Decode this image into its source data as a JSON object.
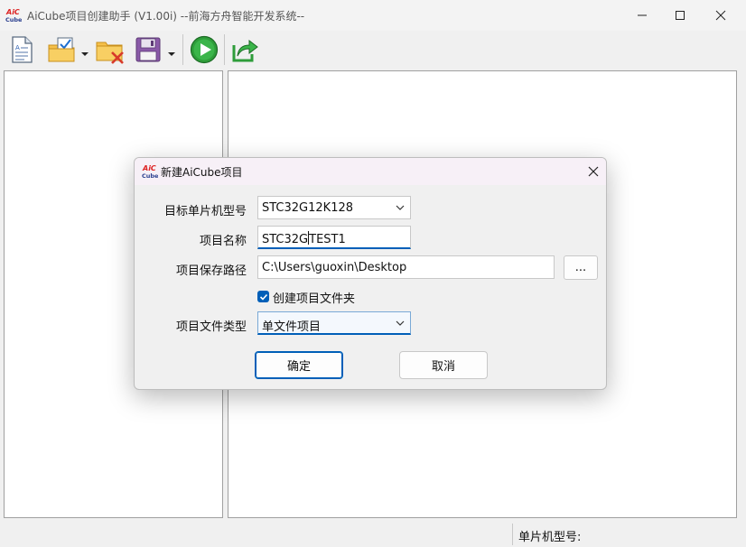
{
  "window": {
    "title": "AiCube项目创建助手 (V1.00i) --前海方舟智能开发系统--",
    "logo_text_top": "AiC",
    "logo_text_bottom": "Cube"
  },
  "toolbar": {
    "items": [
      {
        "name": "new-file",
        "icon": "new-document-icon"
      },
      {
        "name": "open-project",
        "icon": "folder-check-icon",
        "has_dropdown": true
      },
      {
        "name": "close-project",
        "icon": "folder-delete-icon"
      },
      {
        "name": "save",
        "icon": "floppy-disk-icon",
        "has_dropdown": true
      },
      {
        "name": "run",
        "icon": "play-icon"
      },
      {
        "name": "export",
        "icon": "share-arrow-icon"
      }
    ]
  },
  "statusbar": {
    "mcu_label": "单片机型号:"
  },
  "dialog": {
    "title": "新建AiCube项目",
    "fields": {
      "mcu_model_label": "目标单片机型号",
      "mcu_model_value": "STC32G12K128",
      "project_name_label": "项目名称",
      "project_name_before_caret": "STC32G",
      "project_name_after_caret": "TEST1",
      "save_path_label": "项目保存路径",
      "save_path_value": "C:\\Users\\guoxin\\Desktop",
      "browse_label": "...",
      "create_folder_label": "创建项目文件夹",
      "create_folder_checked": true,
      "file_type_label": "项目文件类型",
      "file_type_value": "单文件项目"
    },
    "buttons": {
      "ok": "确定",
      "cancel": "取消"
    }
  },
  "colors": {
    "accent": "#005fb8",
    "window_bg": "#f0f0f0",
    "dialog_title_bg": "#f7f0f7"
  }
}
